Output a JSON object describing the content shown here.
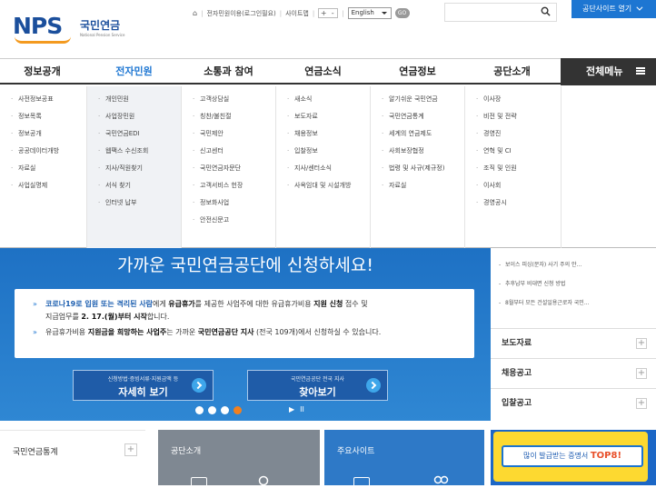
{
  "header": {
    "logo_mark": "NPS",
    "logo_korean": "국민연금",
    "logo_english": "National Pension Service",
    "util_links": [
      "전자민원이용(로그인필요)",
      "사이트맵"
    ],
    "font_size_controls": [
      "+",
      "-"
    ],
    "language": "English",
    "go_label": "GO",
    "search_placeholder": "",
    "site_open_button": "공단사이트 열기"
  },
  "gnb": {
    "items": [
      "정보공개",
      "전자민원",
      "소통과 참여",
      "연금소식",
      "연금정보",
      "공단소개"
    ],
    "active_index": 1,
    "all_menu": "전체메뉴"
  },
  "mega_menu": [
    [
      "사전정보공표",
      "정보목록",
      "정보공개",
      "공공데이터개방",
      "자료실",
      "사업실명제"
    ],
    [
      "개인민원",
      "사업장민원",
      "국민연금EDI",
      "웹팩스 수신조회",
      "지사/직원찾기",
      "서식 찾기",
      "인터넷 납부"
    ],
    [
      "고객상담실",
      "칭찬/불친절",
      "국민제안",
      "신고센터",
      "국민연금자문단",
      "고객서비스 헌장",
      "정보화사업",
      "안전신문고"
    ],
    [
      "새소식",
      "보도자료",
      "채용정보",
      "입찰정보",
      "지사/센터소식",
      "사옥임대 및 시설개방"
    ],
    [
      "알기쉬운 국민연금",
      "국민연금통계",
      "세계의 연금제도",
      "사회보장협정",
      "법령 및 사규(제규정)",
      "자료실"
    ],
    [
      "이사장",
      "비전 및 전략",
      "경영진",
      "연혁 및 CI",
      "조직 및 인원",
      "이사회",
      "경영공시"
    ]
  ],
  "hero": {
    "title": "가까운 국민연금공단에 신청하세요!",
    "para1_highlight": "코로나19로 입원 또는 격리된 사람",
    "para1_text1": "에게 ",
    "para1_bold1": "유급휴가",
    "para1_text2": "를 제공한 사업주에 대한 유급휴가비용 ",
    "para1_bold2": "지원 신청",
    "para1_text3": " 접수 및",
    "para1_line2a": "지급업무를 ",
    "para1_line2b": "2. 17.(월)부터 시작",
    "para1_line2c": "합니다.",
    "para2_text1": "유급휴가비용 ",
    "para2_bold1": "지원금을 희망하는 사업주",
    "para2_text2": "는 가까운 ",
    "para2_bold2": "국민연금공단 지사",
    "para2_text3": " (전국 109개)에서 신청하실 수 있습니다.",
    "btn1_small": "신청방법·증빙서류·지원금액 등",
    "btn1_big": "자세히 보기",
    "btn2_small": "국민연금공단 전국 지사",
    "btn2_big": "찾아보기",
    "slide_count": 4,
    "active_slide": 3,
    "controls": [
      "▶",
      "II"
    ]
  },
  "side": {
    "notices": [
      "보이스 피싱(문자) 사기 주의 안...",
      "추후납부 비대면 신청 방법",
      "8월부터 모든 건설일용근로자 국민..."
    ],
    "sections": [
      "보도자료",
      "채용공고",
      "입찰공고"
    ]
  },
  "bottom": {
    "stats_title": "국민연금통계",
    "intro_title": "공단소개",
    "sites_title": "주요사이트",
    "banner_pre": "많이 발급받는 증명서 ",
    "banner_highlight": "TOP8!"
  },
  "colors": {
    "brand_blue": "#1d76d2",
    "hero_blue": "#2f87d3",
    "accent_orange": "#f2801f",
    "banner_yellow": "#fdd930"
  }
}
